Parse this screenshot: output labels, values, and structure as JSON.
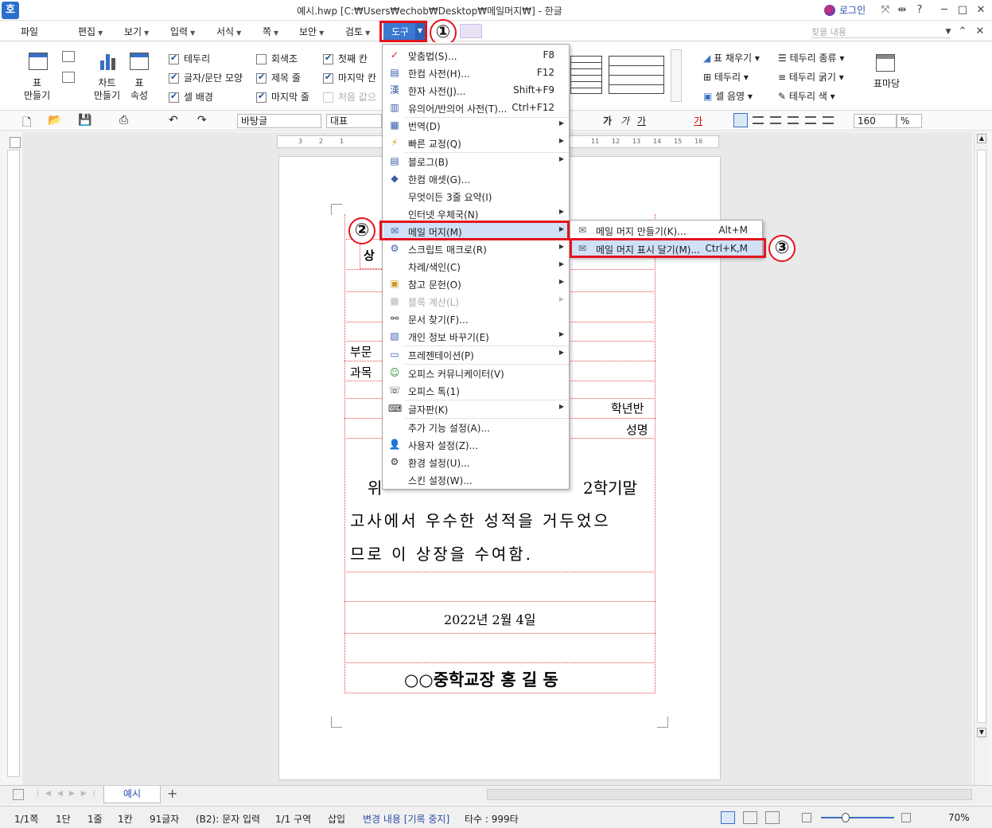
{
  "window": {
    "title": "예시.hwp [C:₩Users₩echob₩Desktop₩메일머지₩] - 한글",
    "login": "로그인",
    "help": "?"
  },
  "app_icon": "호",
  "menubar": {
    "items": [
      "파일",
      "편집",
      "보기",
      "입력",
      "서식",
      "쪽",
      "보안",
      "검토",
      "도구"
    ],
    "search_placeholder": "찾을 내용"
  },
  "ribbon": {
    "table_create": "표\n만들기",
    "chart_create": "차트\n만들기",
    "table_props": "표\n속성",
    "checks_col1": [
      {
        "label": "테두리",
        "checked": true
      },
      {
        "label": "글자/문단 모양",
        "checked": true
      },
      {
        "label": "셀 배경",
        "checked": true
      }
    ],
    "checks_col2": [
      {
        "label": "회색조",
        "checked": false
      },
      {
        "label": "제목 줄",
        "checked": true
      },
      {
        "label": "마지막 줄",
        "checked": true
      }
    ],
    "checks_col3": [
      {
        "label": "첫째 칸",
        "checked": true
      },
      {
        "label": "마지막 칸",
        "checked": true
      },
      {
        "label": "처음 값으",
        "checked": false
      }
    ],
    "right_items": [
      "표 채우기",
      "테두리",
      "셀 음영",
      "테두리 종류",
      "테두리 굵기",
      "테두리 색"
    ],
    "table_madang": "표마당"
  },
  "toolbar2": {
    "style": "바탕글",
    "font_hint": "대표",
    "zoom": "160",
    "zoom_unit": "%"
  },
  "menu": {
    "items": [
      {
        "label": "맞춤법(S)...",
        "shortcut": "F8",
        "icon": "spellcheck-icon"
      },
      {
        "label": "한컴 사전(H)...",
        "shortcut": "F12",
        "icon": "dictionary-icon"
      },
      {
        "label": "한자 사전(J)...",
        "shortcut": "Shift+F9",
        "icon": "hanja-icon"
      },
      {
        "label": "유의어/반의어 사전(T)...",
        "shortcut": "Ctrl+F12",
        "icon": "thesaurus-icon"
      },
      {
        "label": "번역(D)",
        "shortcut": "",
        "icon": "translate-icon",
        "sub": true
      },
      {
        "label": "빠른 교정(Q)",
        "shortcut": "",
        "icon": "quick-correct-icon",
        "sub": true
      },
      {
        "label": "블로그(B)",
        "shortcut": "",
        "icon": "blog-icon",
        "sub": true
      },
      {
        "label": "한컴 애셋(G)...",
        "shortcut": "",
        "icon": "asset-icon"
      },
      {
        "label": "무엇이든 3줄 요약(I)",
        "shortcut": "",
        "icon": ""
      },
      {
        "label": "인터넷 우체국(N)",
        "shortcut": "",
        "icon": "",
        "sub": true
      },
      {
        "label": "메일 머지(M)",
        "shortcut": "",
        "icon": "mail-icon",
        "sub": true
      },
      {
        "label": "스크립트 매크로(R)",
        "shortcut": "",
        "icon": "macro-icon",
        "sub": true
      },
      {
        "label": "차례/색인(C)",
        "shortcut": "",
        "icon": "",
        "sub": true
      },
      {
        "label": "참고 문헌(O)",
        "shortcut": "",
        "icon": "reference-icon",
        "sub": true
      },
      {
        "label": "블록 계산(L)",
        "shortcut": "",
        "icon": "calc-icon",
        "sub": true,
        "disabled": true
      },
      {
        "label": "문서 찾기(F)...",
        "shortcut": "",
        "icon": "binoculars-icon"
      },
      {
        "label": "개인 정보 바꾸기(E)",
        "shortcut": "",
        "icon": "privacy-icon",
        "sub": true
      },
      {
        "label": "프레젠테이션(P)",
        "shortcut": "",
        "icon": "presentation-icon",
        "sub": true
      },
      {
        "label": "오피스 커뮤니케이터(V)",
        "shortcut": "",
        "icon": "communicator-icon"
      },
      {
        "label": "오피스 톡(1)",
        "shortcut": "",
        "icon": "talk-icon"
      },
      {
        "label": "글자판(K)",
        "shortcut": "",
        "icon": "keyboard-icon",
        "sub": true
      },
      {
        "label": "추가 기능 설정(A)...",
        "shortcut": "",
        "icon": ""
      },
      {
        "label": "사용자 설정(Z)...",
        "shortcut": "",
        "icon": "user-settings-icon"
      },
      {
        "label": "환경 설정(U)...",
        "shortcut": "",
        "icon": "gear-icon"
      },
      {
        "label": "스킨 설정(W)...",
        "shortcut": "",
        "icon": ""
      }
    ]
  },
  "submenu": {
    "items": [
      {
        "label": "메일 머지 만들기(K)...",
        "shortcut": "Alt+M"
      },
      {
        "label": "메일 머지 표시 달기(M)...",
        "shortcut": "Ctrl+K,M"
      }
    ]
  },
  "callouts": [
    "①",
    "②",
    "③"
  ],
  "document": {
    "lines": [
      {
        "text": "부문"
      },
      {
        "text": "과목"
      },
      {
        "text": "학년반"
      },
      {
        "text": "성명"
      },
      {
        "text": "위",
        "tail": "2학기말"
      },
      {
        "text": "고사에서 우수한 성적을 거두었으"
      },
      {
        "text": "므로 이 상장을 수여함."
      },
      {
        "text": "2022년 2월 4일"
      },
      {
        "text": "○○중학교장 홍 길 동"
      }
    ],
    "partial": "상"
  },
  "tabs": {
    "sheet": "예시",
    "add": "+"
  },
  "status": [
    "1/1쪽",
    "1단",
    "1줄",
    "1칸",
    "91글자",
    "(B2): 문자 입력",
    "1/1 구역",
    "삽입",
    "변경 내용 [기록 중지]",
    "타수 : 999타",
    "70%"
  ],
  "ruler_marks": [
    "3",
    "2",
    "1",
    "",
    "",
    "",
    "",
    "",
    "",
    "",
    "",
    "11",
    "12",
    "13",
    "14",
    "15",
    "16"
  ]
}
